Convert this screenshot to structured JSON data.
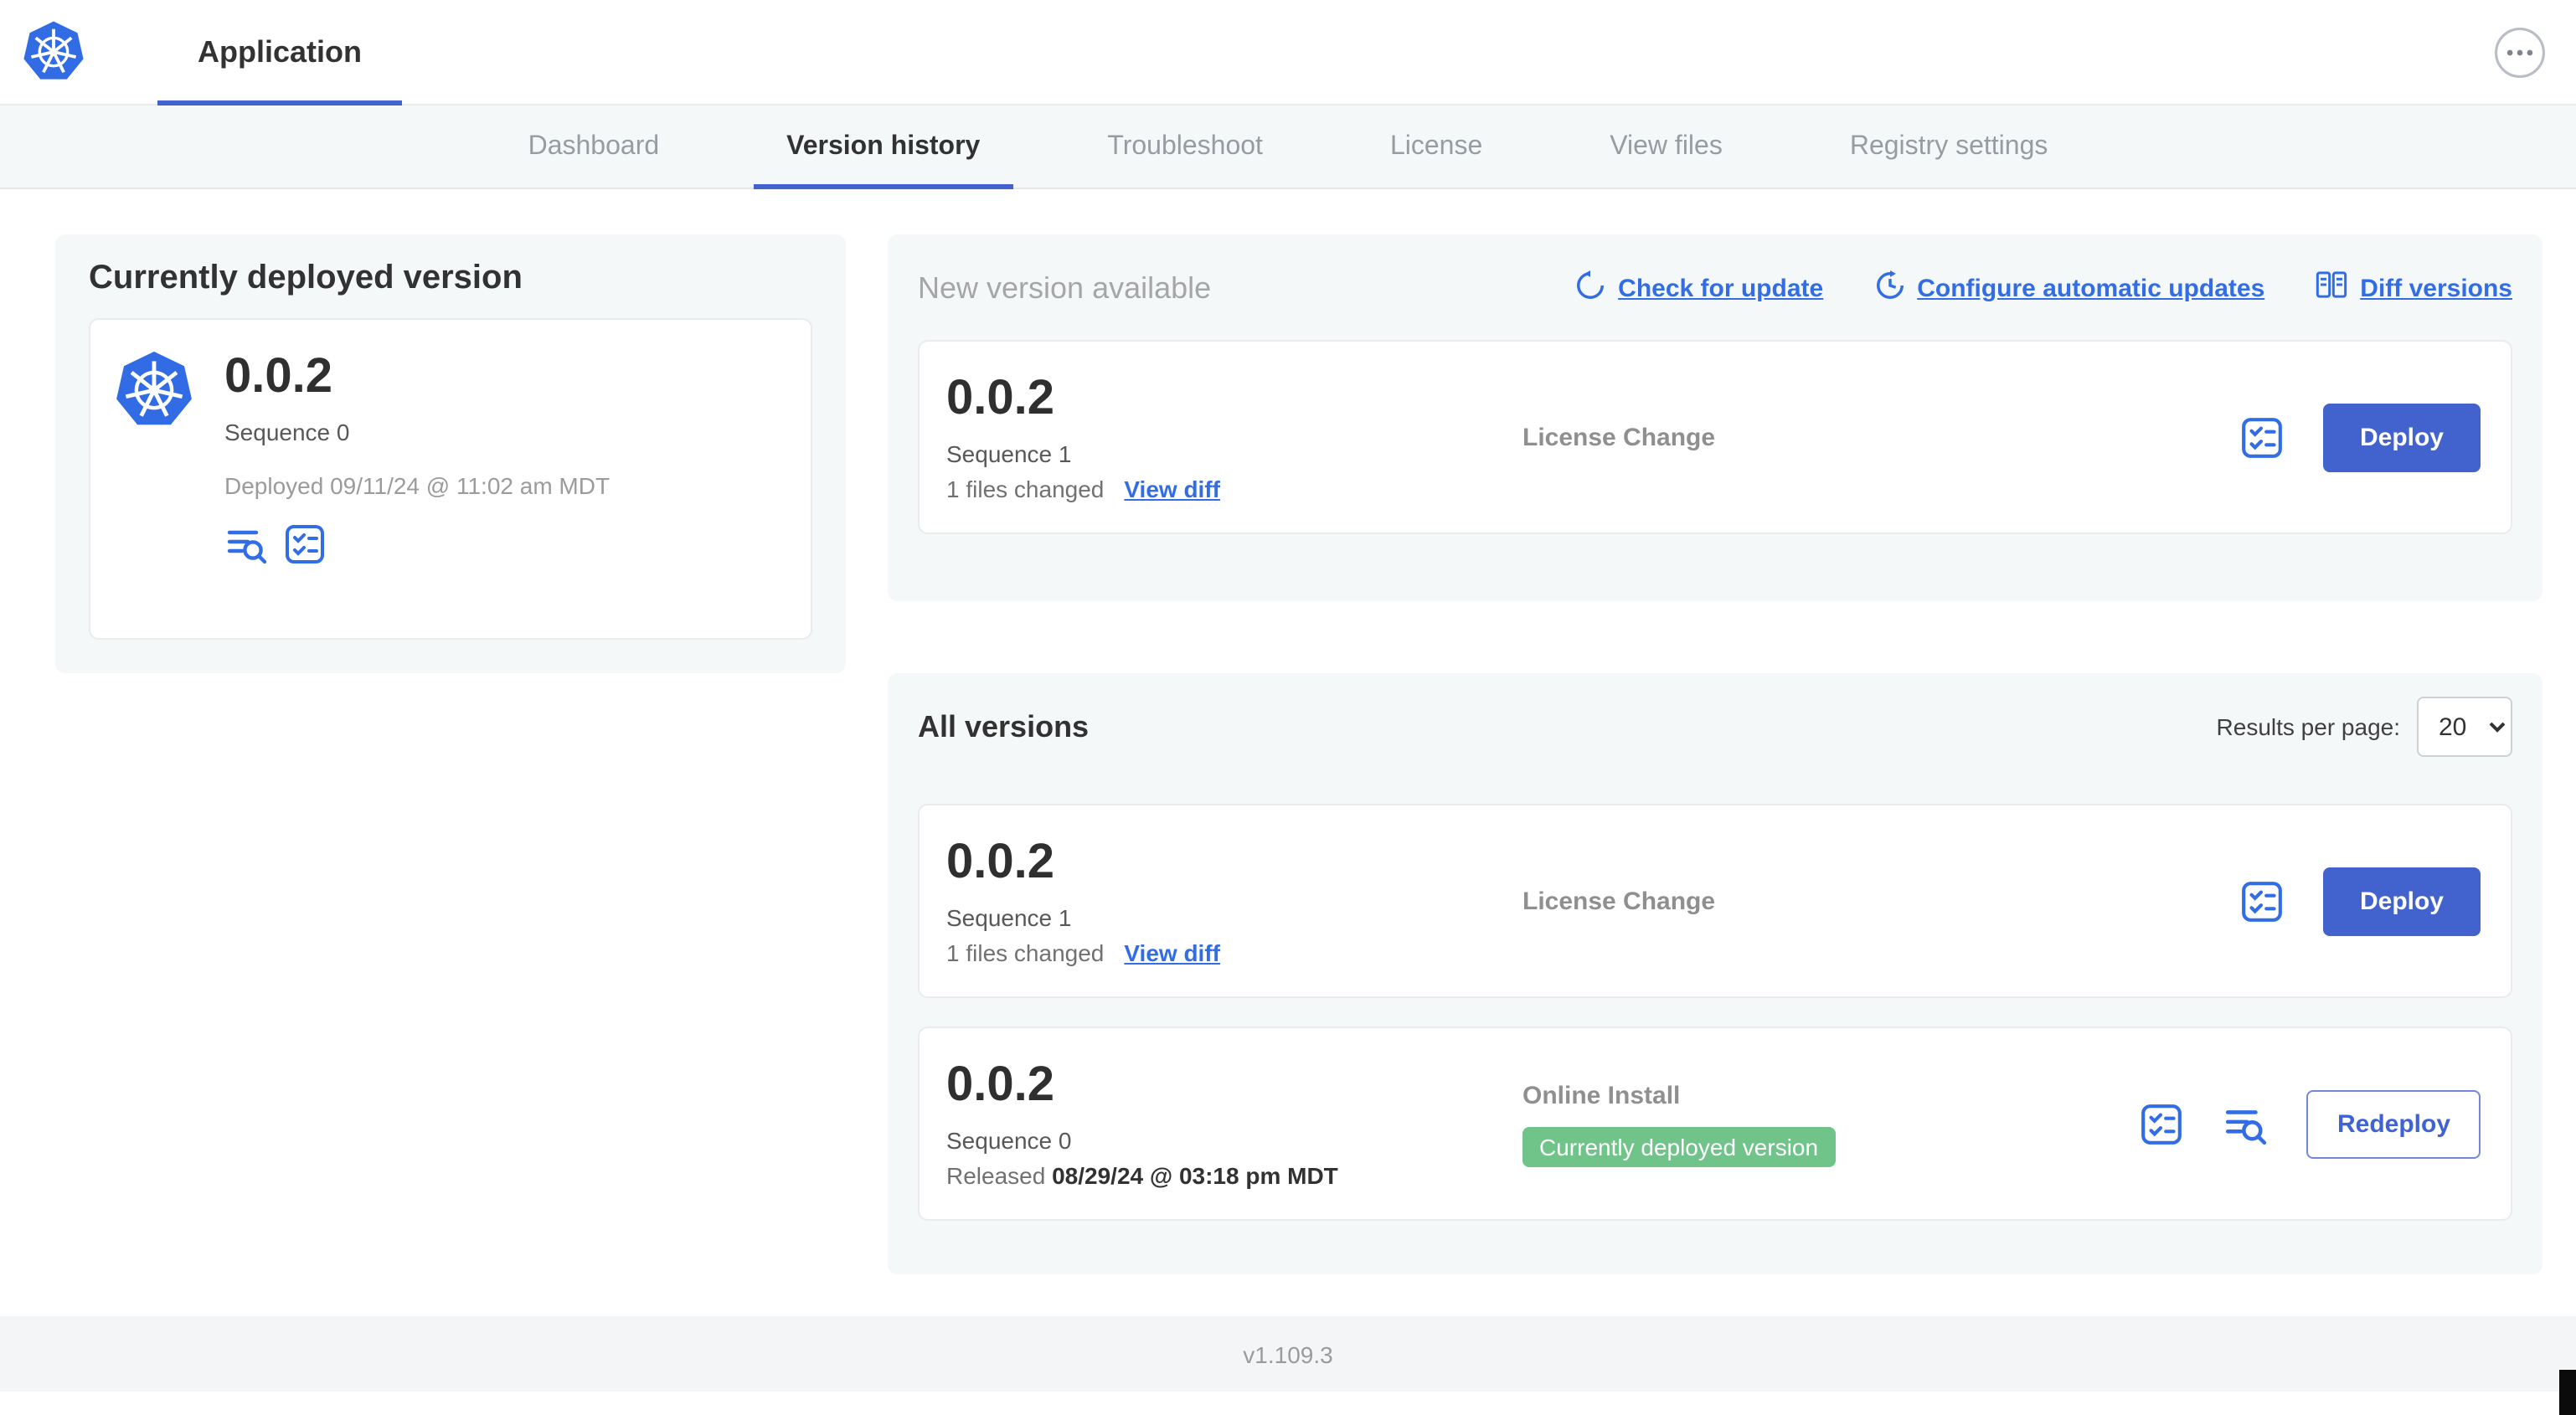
{
  "colors": {
    "brand_blue": "#326ce5",
    "link_blue": "#326de6",
    "button_blue": "#4262cd",
    "badge_green": "#70c489",
    "panel_gray": "#f5f8f9"
  },
  "header": {
    "app_tab": "Application"
  },
  "nav": {
    "tabs": [
      "Dashboard",
      "Version history",
      "Troubleshoot",
      "License",
      "View files",
      "Registry settings"
    ],
    "active_tab": "Version history"
  },
  "current_version": {
    "title": "Currently deployed version",
    "version": "0.0.2",
    "sequence": "Sequence 0",
    "deployed": "Deployed 09/11/24 @ 11:02 am MDT"
  },
  "new_version": {
    "title": "New version available",
    "check_for_update": "Check for update",
    "configure_updates": "Configure automatic updates",
    "diff_versions": "Diff versions",
    "card": {
      "version": "0.0.2",
      "sequence": "Sequence 1",
      "files_changed": "1 files changed",
      "view_diff": "View diff",
      "source": "License Change",
      "deploy": "Deploy"
    }
  },
  "all_versions": {
    "title": "All versions",
    "results_per_page_label": "Results per page:",
    "results_per_page": "20",
    "rows": [
      {
        "version": "0.0.2",
        "sequence": "Sequence 1",
        "files_changed": "1 files changed",
        "view_diff": "View diff",
        "source": "License Change",
        "action": "Deploy"
      },
      {
        "version": "0.0.2",
        "sequence": "Sequence 0",
        "released_label": "Released",
        "released_date": "08/29/24 @ 03:18 pm MDT",
        "source": "Online Install",
        "badge": "Currently deployed version",
        "action": "Redeploy"
      }
    ]
  },
  "footer": {
    "version": "v1.109.3"
  }
}
